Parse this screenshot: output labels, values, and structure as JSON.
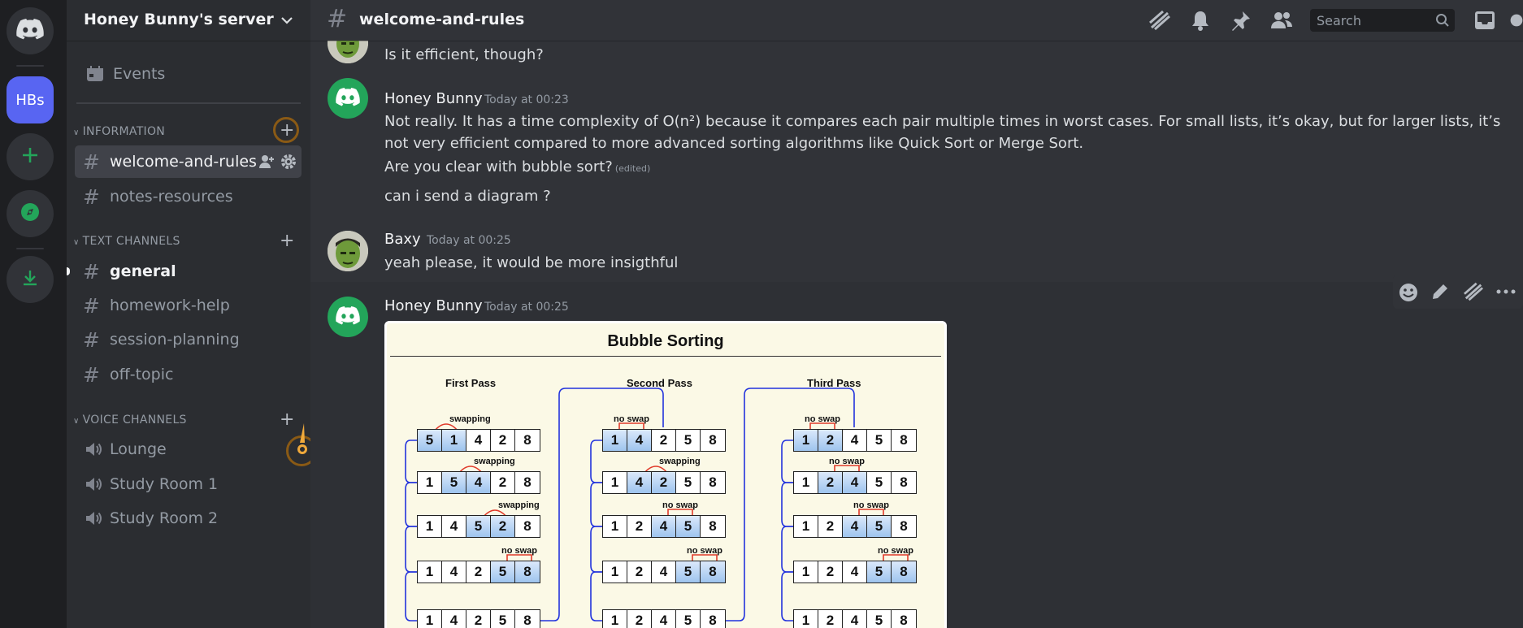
{
  "server": {
    "name": "Honey Bunny's server",
    "abbrev": "HBs"
  },
  "sidebar": {
    "events_label": "Events",
    "categories": [
      {
        "name": "INFORMATION",
        "channels": [
          "welcome-and-rules",
          "notes-resources"
        ]
      },
      {
        "name": "TEXT CHANNELS",
        "channels": [
          "general",
          "homework-help",
          "session-planning",
          "off-topic"
        ]
      },
      {
        "name": "VOICE CHANNELS",
        "channels": [
          "Lounge",
          "Study Room 1",
          "Study Room 2"
        ]
      }
    ]
  },
  "header": {
    "channel": "welcome-and-rules",
    "search_placeholder": "Search"
  },
  "messages": [
    {
      "text": "Is it efficient, though?"
    },
    {
      "author": "Honey Bunny",
      "time": "Today at 00:23",
      "lines": [
        "Not really. It has a time complexity of O(n²) because it compares each pair multiple times in worst cases. For small lists, it’s okay, but for larger lists, it’s not very efficient compared to more advanced sorting algorithms like Quick Sort or Merge Sort.",
        "Are you clear with bubble sort?",
        "can i send a diagram ?"
      ],
      "edited": "(edited)"
    },
    {
      "author": "Baxy",
      "time": "Today at 00:25",
      "text": "yeah please, it would be more insigthful"
    },
    {
      "author": "Honey Bunny",
      "time": "Today at 00:25"
    }
  ],
  "diagram": {
    "title": "Bubble  Sorting",
    "passes": [
      {
        "title": "First  Pass",
        "rows": [
          {
            "values": [
              "5",
              "1",
              "4",
              "2",
              "8"
            ],
            "hl": [
              0,
              1
            ],
            "note": "swapping"
          },
          {
            "values": [
              "1",
              "5",
              "4",
              "2",
              "8"
            ],
            "hl": [
              1,
              2
            ],
            "note": "swapping"
          },
          {
            "values": [
              "1",
              "4",
              "5",
              "2",
              "8"
            ],
            "hl": [
              2,
              3
            ],
            "note": "swapping"
          },
          {
            "values": [
              "1",
              "4",
              "2",
              "5",
              "8"
            ],
            "hl": [
              3,
              4
            ],
            "note": "no swap"
          },
          {
            "values": [
              "1",
              "4",
              "2",
              "5",
              "8"
            ],
            "hl": [],
            "note": ""
          }
        ]
      },
      {
        "title": "Second  Pass",
        "rows": [
          {
            "values": [
              "1",
              "4",
              "2",
              "5",
              "8"
            ],
            "hl": [
              0,
              1
            ],
            "note": "no swap"
          },
          {
            "values": [
              "1",
              "4",
              "2",
              "5",
              "8"
            ],
            "hl": [
              1,
              2
            ],
            "note": "swapping"
          },
          {
            "values": [
              "1",
              "2",
              "4",
              "5",
              "8"
            ],
            "hl": [
              2,
              3
            ],
            "note": "no swap"
          },
          {
            "values": [
              "1",
              "2",
              "4",
              "5",
              "8"
            ],
            "hl": [
              3,
              4
            ],
            "note": "no swap"
          },
          {
            "values": [
              "1",
              "2",
              "4",
              "5",
              "8"
            ],
            "hl": [],
            "note": ""
          }
        ]
      },
      {
        "title": "Third  Pass",
        "rows": [
          {
            "values": [
              "1",
              "2",
              "4",
              "5",
              "8"
            ],
            "hl": [
              0,
              1
            ],
            "note": "no swap"
          },
          {
            "values": [
              "1",
              "2",
              "4",
              "5",
              "8"
            ],
            "hl": [
              1,
              2
            ],
            "note": "no swap"
          },
          {
            "values": [
              "1",
              "2",
              "4",
              "5",
              "8"
            ],
            "hl": [
              2,
              3
            ],
            "note": "no swap"
          },
          {
            "values": [
              "1",
              "2",
              "4",
              "5",
              "8"
            ],
            "hl": [
              3,
              4
            ],
            "note": "no swap"
          },
          {
            "values": [
              "1",
              "2",
              "4",
              "5",
              "8"
            ],
            "hl": [],
            "note": ""
          }
        ]
      }
    ]
  },
  "colors": {
    "brand": "#5865f2",
    "green": "#23a55a",
    "bg": "#313338",
    "sidebar": "#2b2d31",
    "rail": "#1e1f22"
  }
}
